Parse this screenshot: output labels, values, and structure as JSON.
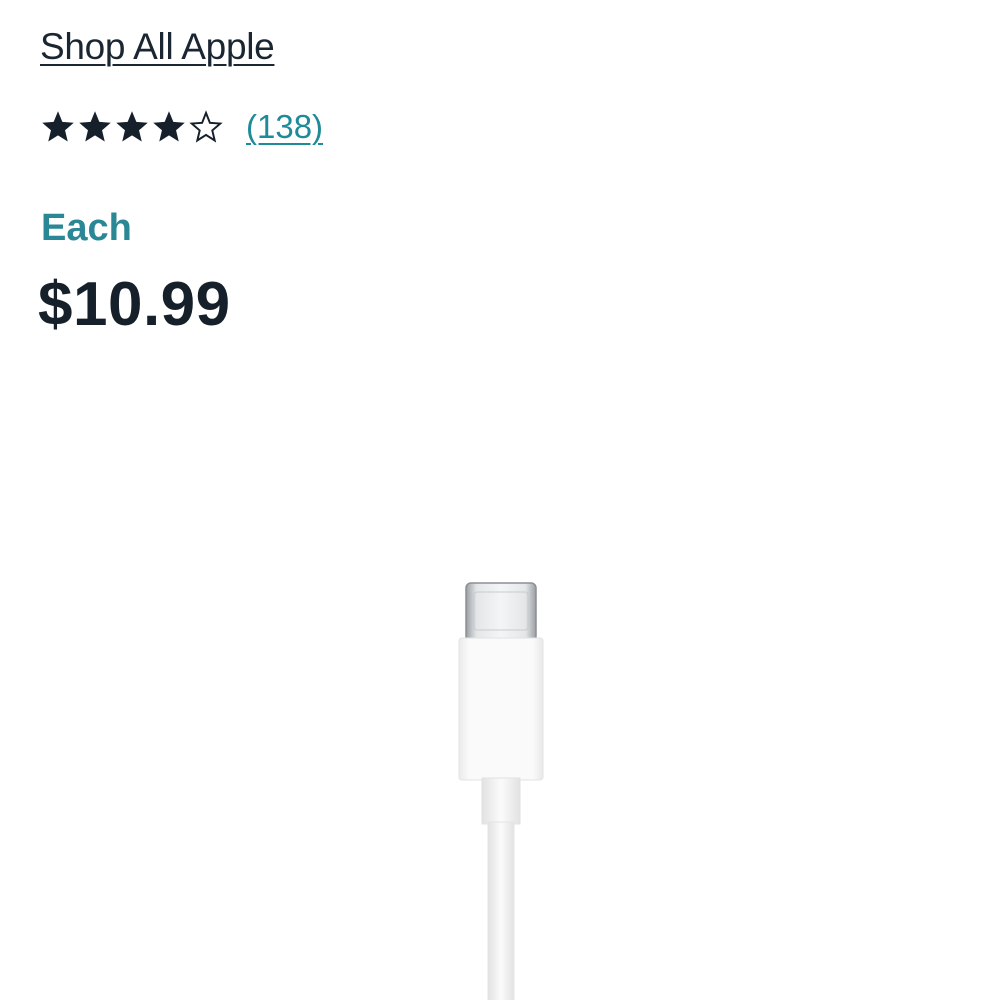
{
  "shop_link": {
    "label": "Shop All Apple"
  },
  "rating": {
    "stars_filled": 4,
    "stars_total": 5,
    "review_count": "(138)",
    "star_color": "#16202b"
  },
  "price": {
    "unit_label": "Each",
    "amount": "$10.99",
    "unit_color": "#2a8795"
  },
  "product_image": {
    "icon": "usb-c-cable-image"
  }
}
